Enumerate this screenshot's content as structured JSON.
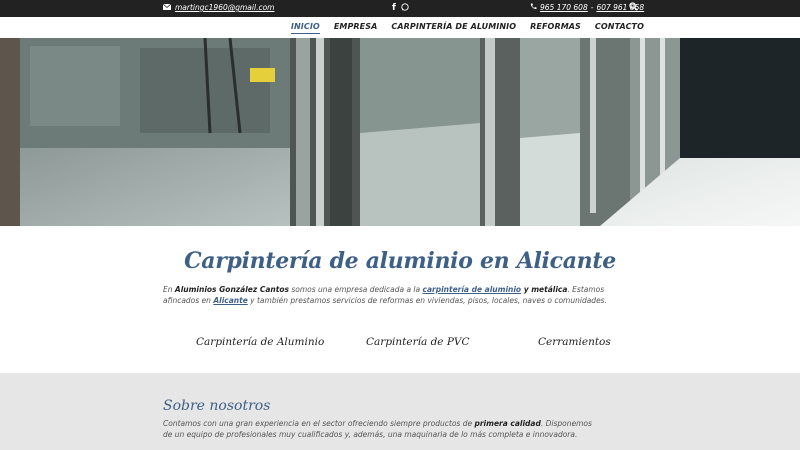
{
  "topbar": {
    "email": "martingc1960@gmail.com",
    "phone1": "965 170 608",
    "separator": "-",
    "phone2": "607 961 858",
    "icons": [
      "envelope-icon",
      "facebook-icon",
      "whatsapp-icon",
      "phone-icon",
      "search-icon"
    ]
  },
  "nav": {
    "items": [
      {
        "label": "INICIO",
        "active": true
      },
      {
        "label": "EMPRESA",
        "active": false
      },
      {
        "label": "CARPINTERÍA DE ALUMINIO",
        "active": false
      },
      {
        "label": "REFORMAS",
        "active": false
      },
      {
        "label": "CONTACTO",
        "active": false
      }
    ]
  },
  "main": {
    "title": "Carpintería de aluminio en Alicante",
    "intro": {
      "p1": "En ",
      "company": "Aluminios González Cantos",
      "p2": " somos una empresa dedicada a la ",
      "link1": "carpintería de aluminio",
      "p3": " y metálica",
      "p4": ". Estamos afincados en ",
      "link2": "Alicante",
      "p5": " y también prestamos servicios de reformas en viviendas, pisos, locales, naves o comunidades."
    },
    "services": [
      "Carpintería de Aluminio",
      "Carpintería de PVC",
      "Cerramientos"
    ]
  },
  "about": {
    "title": "Sobre nosotros",
    "p1": "Contamos con una gran experiencia en el sector ofreciendo siempre productos de ",
    "bold": "primera calidad",
    "p2": ". Disponemos de un equipo de profesionales muy cualificados y, además, una maquinaria de lo más completa e innovadora."
  },
  "colors": {
    "accent": "#3e5f86",
    "topbar": "#222222",
    "about_bg": "#e6e6e6"
  }
}
